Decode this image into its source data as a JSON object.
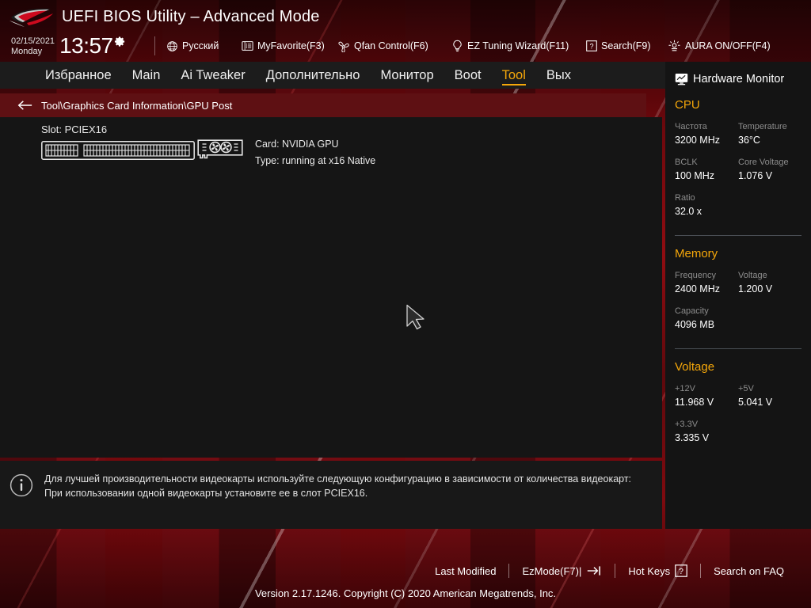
{
  "header": {
    "logo_icon": "rog-eye-logo",
    "title": "UEFI BIOS Utility – Advanced Mode",
    "date": "02/15/2021",
    "day": "Monday",
    "time": "13:57",
    "gear_icon": "gear-icon",
    "items": [
      {
        "label": "Русский",
        "icon": "globe-icon"
      },
      {
        "label": "MyFavorite(F3)",
        "icon": "list-icon"
      },
      {
        "label": "Qfan Control(F6)",
        "icon": "fan-icon"
      },
      {
        "label": "EZ Tuning Wizard(F11)",
        "icon": "lightbulb-icon"
      },
      {
        "label": "Search(F9)",
        "icon": "question-box-icon"
      },
      {
        "label": "AURA ON/OFF(F4)",
        "icon": "aura-light-icon"
      }
    ]
  },
  "nav": {
    "tabs": [
      {
        "label": "Избранное",
        "active": false
      },
      {
        "label": "Main",
        "active": false
      },
      {
        "label": "Ai Tweaker",
        "active": false
      },
      {
        "label": "Дополнительно",
        "active": false
      },
      {
        "label": "Монитор",
        "active": false
      },
      {
        "label": "Boot",
        "active": false
      },
      {
        "label": "Tool",
        "active": true
      },
      {
        "label": "Вых",
        "active": false
      }
    ]
  },
  "breadcrumb": {
    "back_icon": "back-arrow-icon",
    "path": "Tool\\Graphics Card Information\\GPU Post"
  },
  "content": {
    "slot_label": "Slot: PCIEX16",
    "slot_icon": "pcie-slot-icon",
    "card_icon": "graphics-card-icon",
    "card_line": "Card: NVIDIA GPU",
    "type_line": "Type: running at x16 Native"
  },
  "help": {
    "icon": "info-icon",
    "line1": "Для лучшей производительности видеокарты используйте следующую конфигурацию в зависимости от количества видеокарт:",
    "line2": "При использовании одной видеокарты установите ее в слот PCIEX16."
  },
  "hardware_monitor": {
    "title": "Hardware Monitor",
    "title_icon": "monitor-icon",
    "groups": [
      {
        "name": "CPU",
        "rows": [
          [
            {
              "key": "Частота",
              "value": "3200 MHz"
            },
            {
              "key": "Temperature",
              "value": "36°C"
            }
          ],
          [
            {
              "key": "BCLK",
              "value": "100 MHz"
            },
            {
              "key": "Core Voltage",
              "value": "1.076 V"
            }
          ],
          [
            {
              "key": "Ratio",
              "value": "32.0 x"
            }
          ]
        ]
      },
      {
        "name": "Memory",
        "rows": [
          [
            {
              "key": "Frequency",
              "value": "2400 MHz"
            },
            {
              "key": "Voltage",
              "value": "1.200 V"
            }
          ],
          [
            {
              "key": "Capacity",
              "value": "4096 MB"
            }
          ]
        ]
      },
      {
        "name": "Voltage",
        "rows": [
          [
            {
              "key": "+12V",
              "value": "11.968 V"
            },
            {
              "key": "+5V",
              "value": "5.041 V"
            }
          ],
          [
            {
              "key": "+3.3V",
              "value": "3.335 V"
            }
          ]
        ]
      }
    ]
  },
  "footer": {
    "links": [
      {
        "label": "Last Modified",
        "icon": ""
      },
      {
        "label": "EzMode(F7)|",
        "icon": "arrow-into-bar-icon"
      },
      {
        "label": "Hot Keys",
        "icon": "question-box-icon"
      },
      {
        "label": "Search on FAQ",
        "icon": ""
      }
    ],
    "version": "Version 2.17.1246. Copyright (C) 2020 American Megatrends, Inc."
  },
  "colors": {
    "accent": "#f5a70a",
    "breadcrumb_bg": "#5e1013",
    "panel_bg": "#151515",
    "sidebar_bg": "#141414"
  }
}
